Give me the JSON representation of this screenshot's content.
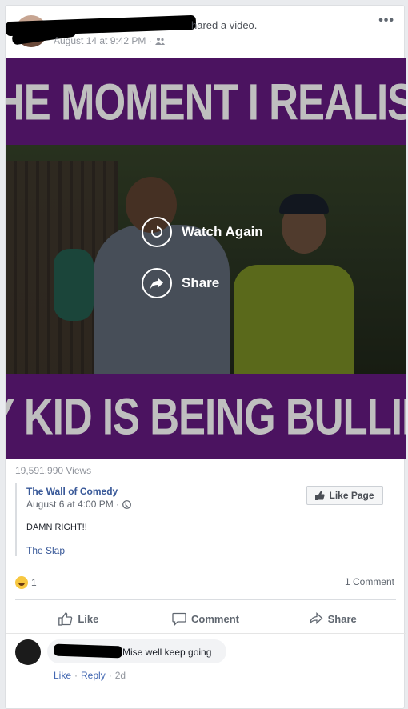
{
  "post": {
    "header_suffix": "hared a video.",
    "timestamp": "August 14 at 9:42 PM ·",
    "audience_icon": "friends-icon",
    "more_icon": "•••"
  },
  "video": {
    "caption_top": "THE MOMENT I REALISE",
    "caption_bottom": "MY KID IS BEING BULLIED",
    "watch_again_label": "Watch Again",
    "share_label": "Share",
    "views": "19,591,990 Views"
  },
  "shared_post": {
    "page_name": "The Wall of Comedy",
    "date": "August 6 at 4:00 PM ·",
    "text": "DAMN RIGHT!!",
    "tag": "The Slap",
    "like_page_label": "Like Page"
  },
  "stats": {
    "reaction_count": "1",
    "comment_count": "1 Comment"
  },
  "actions": {
    "like": "Like",
    "comment": "Comment",
    "share": "Share"
  },
  "comment": {
    "text": "Mise well keep going",
    "like": "Like",
    "separator": "·",
    "reply": "Reply",
    "age": "2d"
  },
  "colors": {
    "link": "#385898",
    "band": "#4b1360",
    "caption": "#bfbfbf"
  }
}
